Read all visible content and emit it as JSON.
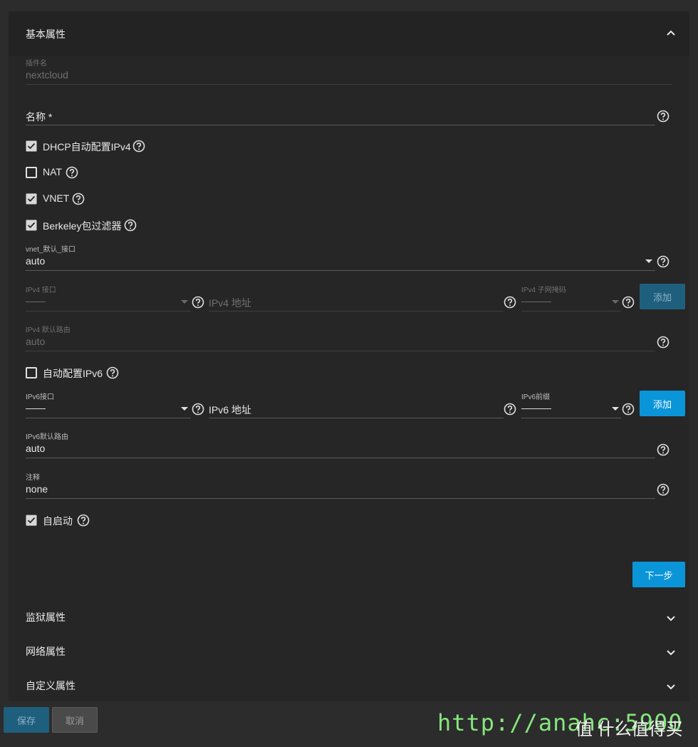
{
  "sections": {
    "basic": {
      "title": "基本属性"
    },
    "jail": {
      "title": "监狱属性"
    },
    "network": {
      "title": "网络属性"
    },
    "custom": {
      "title": "自定义属性"
    }
  },
  "fields": {
    "plugin_name": {
      "label": "插件名",
      "value": "nextcloud"
    },
    "name": {
      "label": "名称 *",
      "value": ""
    },
    "vnet_default_interface": {
      "label": "vnet_默认_接口",
      "value": "auto"
    },
    "ipv4_interface": {
      "label": "IPv4 接口",
      "value": "——"
    },
    "ipv4_address": {
      "placeholder": "IPv4 地址"
    },
    "ipv4_netmask": {
      "label": "IPv4 子网掩码",
      "value": "———"
    },
    "ipv4_default_router": {
      "label": "IPv4 默认路由",
      "value": "auto"
    },
    "ipv6_interface": {
      "label": "IPv6接口",
      "value": "——"
    },
    "ipv6_address": {
      "placeholder": "IPv6 地址"
    },
    "ipv6_prefix": {
      "label": "IPv6前缀",
      "value": "———"
    },
    "ipv6_default_router": {
      "label": "IPv6默认路由",
      "value": "auto"
    },
    "notes": {
      "label": "注释",
      "value": "none"
    }
  },
  "checkboxes": {
    "dhcp": {
      "label": "DHCP自动配置IPv4",
      "checked": true
    },
    "nat": {
      "label": "NAT",
      "checked": false
    },
    "vnet": {
      "label": "VNET",
      "checked": true
    },
    "bpf": {
      "label": "Berkeley包过滤器",
      "checked": true
    },
    "auto_ipv6": {
      "label": "自动配置IPv6",
      "checked": false
    },
    "autostart": {
      "label": "自启动",
      "checked": true
    }
  },
  "buttons": {
    "ipv4_add": "添加",
    "ipv6_add": "添加",
    "next": "下一步",
    "save": "保存",
    "cancel": "取消"
  },
  "watermark": {
    "url": "http://anahc:5900",
    "brand": "值 什么值得买"
  },
  "colors": {
    "accent": "#0a95d8",
    "background": "#2c2c2c",
    "panel": "#262626",
    "watermark_url": "#86e67e"
  },
  "icons": {
    "help": "help-circle-icon",
    "collapse": "chevron-up-icon",
    "expand": "chevron-down-icon",
    "dropdown": "caret-down-icon",
    "checkbox_checked": "checkbox-checked-icon",
    "checkbox_unchecked": "checkbox-unchecked-icon"
  }
}
